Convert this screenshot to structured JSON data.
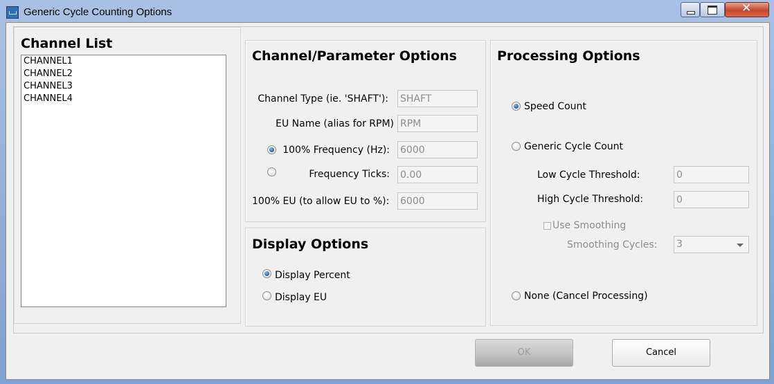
{
  "window": {
    "title": "Generic Cycle Counting Options",
    "controls": [
      "minimize-icon",
      "maximize-icon",
      "close-icon"
    ],
    "close_glyph": "✕"
  },
  "channel_list": {
    "title": "Channel List",
    "items": [
      "CHANNEL1",
      "CHANNEL2",
      "CHANNEL3",
      "CHANNEL4"
    ]
  },
  "channel_params": {
    "title": "Channel/Parameter Options",
    "channel_type_label": "Channel Type (ie. 'SHAFT'):",
    "channel_type_value": "SHAFT",
    "eu_name_label": "EU Name (alias for RPM)",
    "eu_name_value": "RPM",
    "freq_label": "100% Frequency (Hz):",
    "freq_value": "6000",
    "freq_selected": true,
    "ticks_label": "Frequency Ticks:",
    "ticks_value": "0.00",
    "ticks_selected": false,
    "eu_pct_label": "100% EU (to allow EU to %):",
    "eu_pct_value": "6000"
  },
  "display_options": {
    "title": "Display Options",
    "percent_label": "Display Percent",
    "percent_selected": true,
    "eu_label": "Display EU",
    "eu_selected": false
  },
  "processing": {
    "title": "Processing Options",
    "speed_label": "Speed Count",
    "speed_selected": true,
    "generic_label": "Generic Cycle Count",
    "generic_selected": false,
    "low_label": "Low Cycle Threshold:",
    "low_value": "0",
    "high_label": "High Cycle Threshold:",
    "high_value": "0",
    "smoothing_label": "Use Smoothing",
    "smoothing_checked": false,
    "cycles_label": "Smoothing Cycles:",
    "cycles_value": "3",
    "none_label": "None (Cancel Processing)",
    "none_selected": false
  },
  "buttons": {
    "ok": "OK",
    "cancel": "Cancel"
  },
  "colors": {
    "accent": "#10407a",
    "titlebar": "#a9c1e4",
    "disabled_text": "#8d8d8d"
  }
}
